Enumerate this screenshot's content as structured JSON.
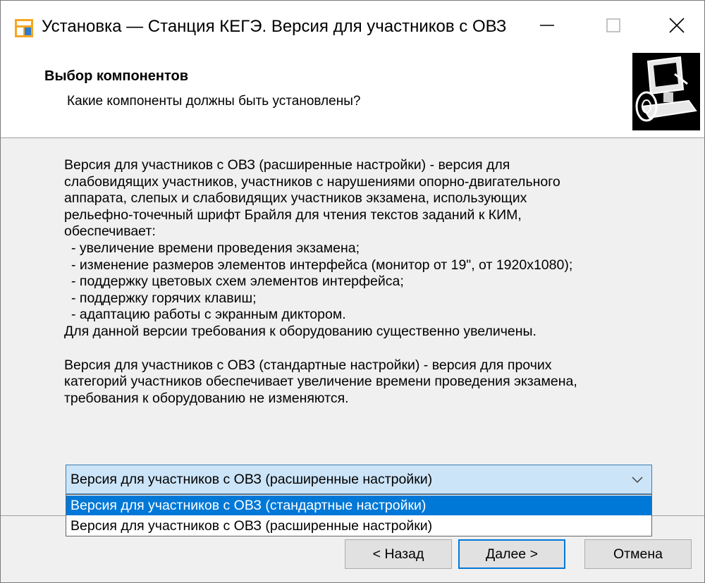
{
  "window": {
    "title": "Установка — Станция КЕГЭ. Версия для участников с ОВЗ"
  },
  "header": {
    "title": "Выбор компонентов",
    "subtitle": "Какие компоненты должны быть установлены?"
  },
  "description": {
    "paragraph1_lines": [
      "Версия для участников с ОВЗ (расширенные настройки) - версия для",
      "слабовидящих участников, участников с нарушениями опорно-двигательного",
      "аппарата, слепых и слабовидящих участников экзамена, использующих",
      "рельефно-точечный шрифт Брайля для чтения текстов заданий к КИМ,",
      "обеспечивает:"
    ],
    "bullets": [
      "- увеличение времени проведения экзамена;",
      "- изменение размеров элементов интерфейса (монитор от 19\", от 1920x1080);",
      "- поддержку цветовых схем элементов интерфейса;",
      "- поддержку горячих клавиш;",
      "- адаптацию работы с экранным диктором."
    ],
    "note": "Для данной версии требования к оборудованию существенно увеличены.",
    "paragraph2_lines": [
      "Версия для участников с ОВЗ (стандартные настройки) - версия для прочих",
      "категорий участников обеспечивает увеличение времени проведения экзамена,",
      "требования к оборудованию не изменяются."
    ]
  },
  "combo": {
    "selected_value": "Версия для участников с ОВЗ (расширенные настройки)",
    "options": [
      "Версия для участников с ОВЗ (стандартные настройки)",
      "Версия для участников с ОВЗ (расширенные настройки)"
    ],
    "highlighted_index": 0
  },
  "buttons": {
    "back": "< Назад",
    "next": "Далее >",
    "cancel": "Отмена"
  },
  "colors": {
    "accent": "#0078d7",
    "combo_bg": "#cce4f7",
    "dialog_bg": "#f0f0f0"
  },
  "icons": {
    "app": "installer-app-icon",
    "header": "computer-install-icon",
    "combo_arrow": "chevron-down-icon"
  }
}
